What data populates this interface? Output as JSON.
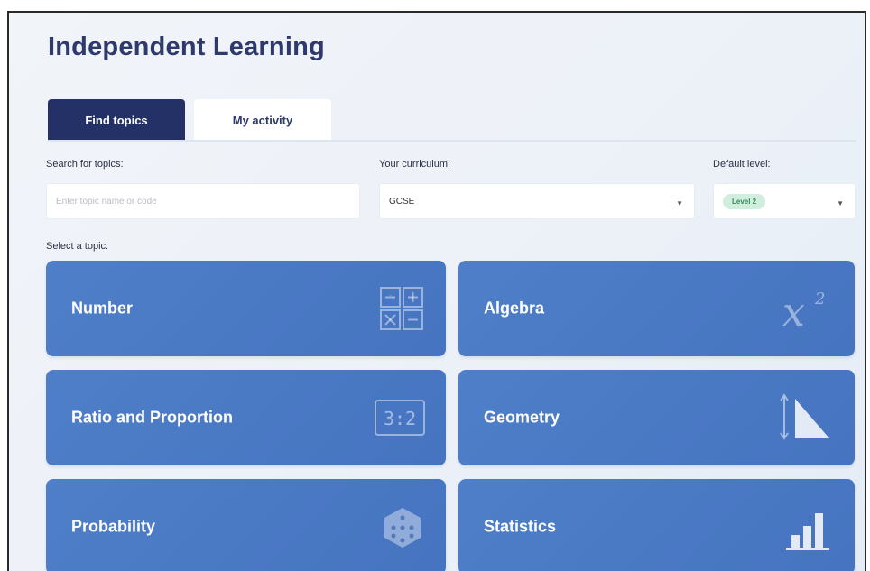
{
  "page": {
    "title": "Independent Learning"
  },
  "tabs": [
    {
      "label": "Find topics",
      "active": true
    },
    {
      "label": "My activity",
      "active": false
    }
  ],
  "search": {
    "label": "Search for topics:",
    "placeholder": "Enter topic name or code",
    "value": ""
  },
  "curriculum": {
    "label": "Your curriculum:",
    "value": "GCSE"
  },
  "level": {
    "label": "Default level:",
    "value": "Level 2"
  },
  "topics": {
    "label": "Select a topic:",
    "items": [
      {
        "label": "Number",
        "icon": "operations-grid-icon"
      },
      {
        "label": "Algebra",
        "icon": "x-squared-icon"
      },
      {
        "label": "Ratio and Proportion",
        "icon": "ratio-icon"
      },
      {
        "label": "Geometry",
        "icon": "triangle-icon"
      },
      {
        "label": "Probability",
        "icon": "dice-icon"
      },
      {
        "label": "Statistics",
        "icon": "bar-chart-icon"
      }
    ]
  },
  "colors": {
    "accent": "#233166",
    "card": "#4a78c4",
    "title": "#2d3a6b",
    "level_pill": "#cfeedd"
  }
}
